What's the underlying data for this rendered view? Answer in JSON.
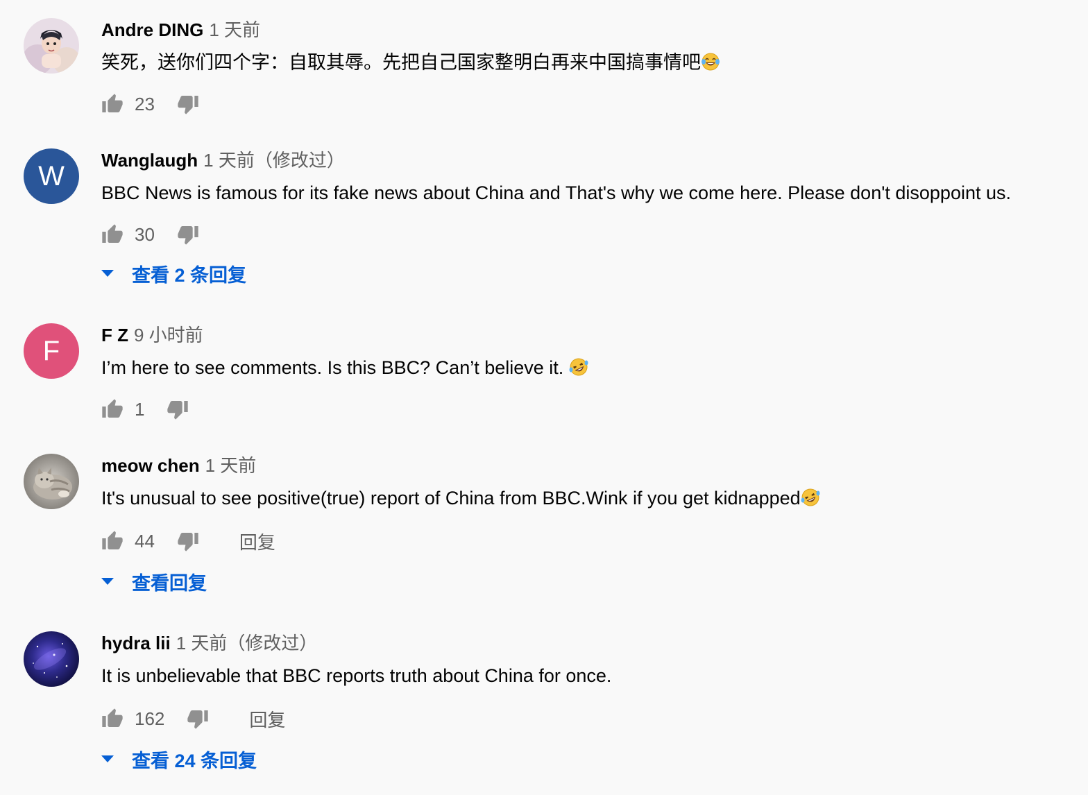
{
  "comments": [
    {
      "author": "Andre DING",
      "time": "1 天前",
      "text": "笑死，送你们四个字：自取其辱。先把自己国家整明白再来中国搞事情吧",
      "emoji": "tears-of-joy-emoji",
      "likes": "23",
      "avatar": {
        "type": "image",
        "icon": "anime-avatar"
      }
    },
    {
      "author": "Wanglaugh",
      "time": "1 天前（修改过）",
      "text": "BBC News is famous for its fake news about China and That's why we come here. Please don't disoppoint us.",
      "likes": "30",
      "avatar": {
        "type": "letter",
        "letter": "W",
        "color": "#2a5699"
      },
      "view_replies": "查看 2 条回复"
    },
    {
      "author": "F Z",
      "time": "9 小时前",
      "text": "I’m here to see comments. Is this BBC? Can’t believe it. ",
      "emoji": "rolling-on-floor-laughing-emoji",
      "likes": "1",
      "avatar": {
        "type": "letter",
        "letter": "F",
        "color": "#e0517a"
      }
    },
    {
      "author": "meow chen",
      "time": "1 天前",
      "text": "It's unusual to see positive(true) report of China from BBC.Wink if you get kidnapped",
      "emoji": "rolling-on-floor-laughing-emoji",
      "likes": "44",
      "reply": "回复",
      "avatar": {
        "type": "image",
        "icon": "cat-avatar"
      },
      "view_replies": "查看回复"
    },
    {
      "author": "hydra lii",
      "time": "1 天前（修改过）",
      "text": "It is unbelievable that BBC reports truth about China for once.",
      "likes": "162",
      "reply": "回复",
      "avatar": {
        "type": "image",
        "icon": "galaxy-avatar"
      },
      "view_replies": "查看 24 条回复"
    }
  ],
  "colors": {
    "background": "#f9f9f9",
    "link": "#065fd4",
    "secondary_text": "#606060",
    "icon": "#909090"
  }
}
